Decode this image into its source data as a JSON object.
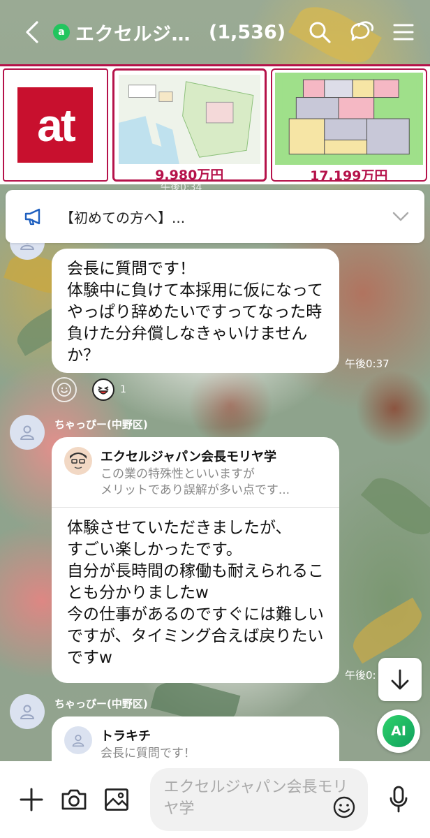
{
  "header": {
    "title": "エクセルジ…",
    "member_count": "(1,536)",
    "openchat_badge": "a"
  },
  "ad": {
    "logo_text": "at",
    "cards": [
      {
        "price": "9,980万円"
      },
      {
        "price": "17,199万円"
      }
    ],
    "overlay_time": "午後0:34"
  },
  "notice": {
    "text": "【初めての方へ】..."
  },
  "messages": [
    {
      "text": "会長に質問です！\n体験中に負けて本採用に仮になってやっぱり辞めたいですってなった時負けた分弁償しなきゃいけませんか？",
      "time": "午後0:37",
      "reaction_count": "1"
    },
    {
      "sender": "ちゃっぴー(中野区)",
      "reply_to_name": "エクセルジャパン会長モリヤ学",
      "reply_to_text": "この業の特殊性といいますが\nメリットであり誤解が多い点です...",
      "text": "体験させていただきましたが、\nすごい楽しかったです。\n自分が長時間の稼働も耐えられることも分かりましたw\n今の仕事があるのですぐには難しいですが、タイミング合えば戻りたいですw",
      "time": "午後0:"
    },
    {
      "sender": "ちゃっぴー(中野区)",
      "reply_to_name": "トラキチ",
      "reply_to_text": "会長に質問です！"
    }
  ],
  "fab": {
    "ai_label": "AI"
  },
  "composer": {
    "placeholder": "エクセルジャパン会長モリヤ学"
  },
  "colors": {
    "accent": "#b5124a",
    "brand_green": "#22c55e"
  }
}
